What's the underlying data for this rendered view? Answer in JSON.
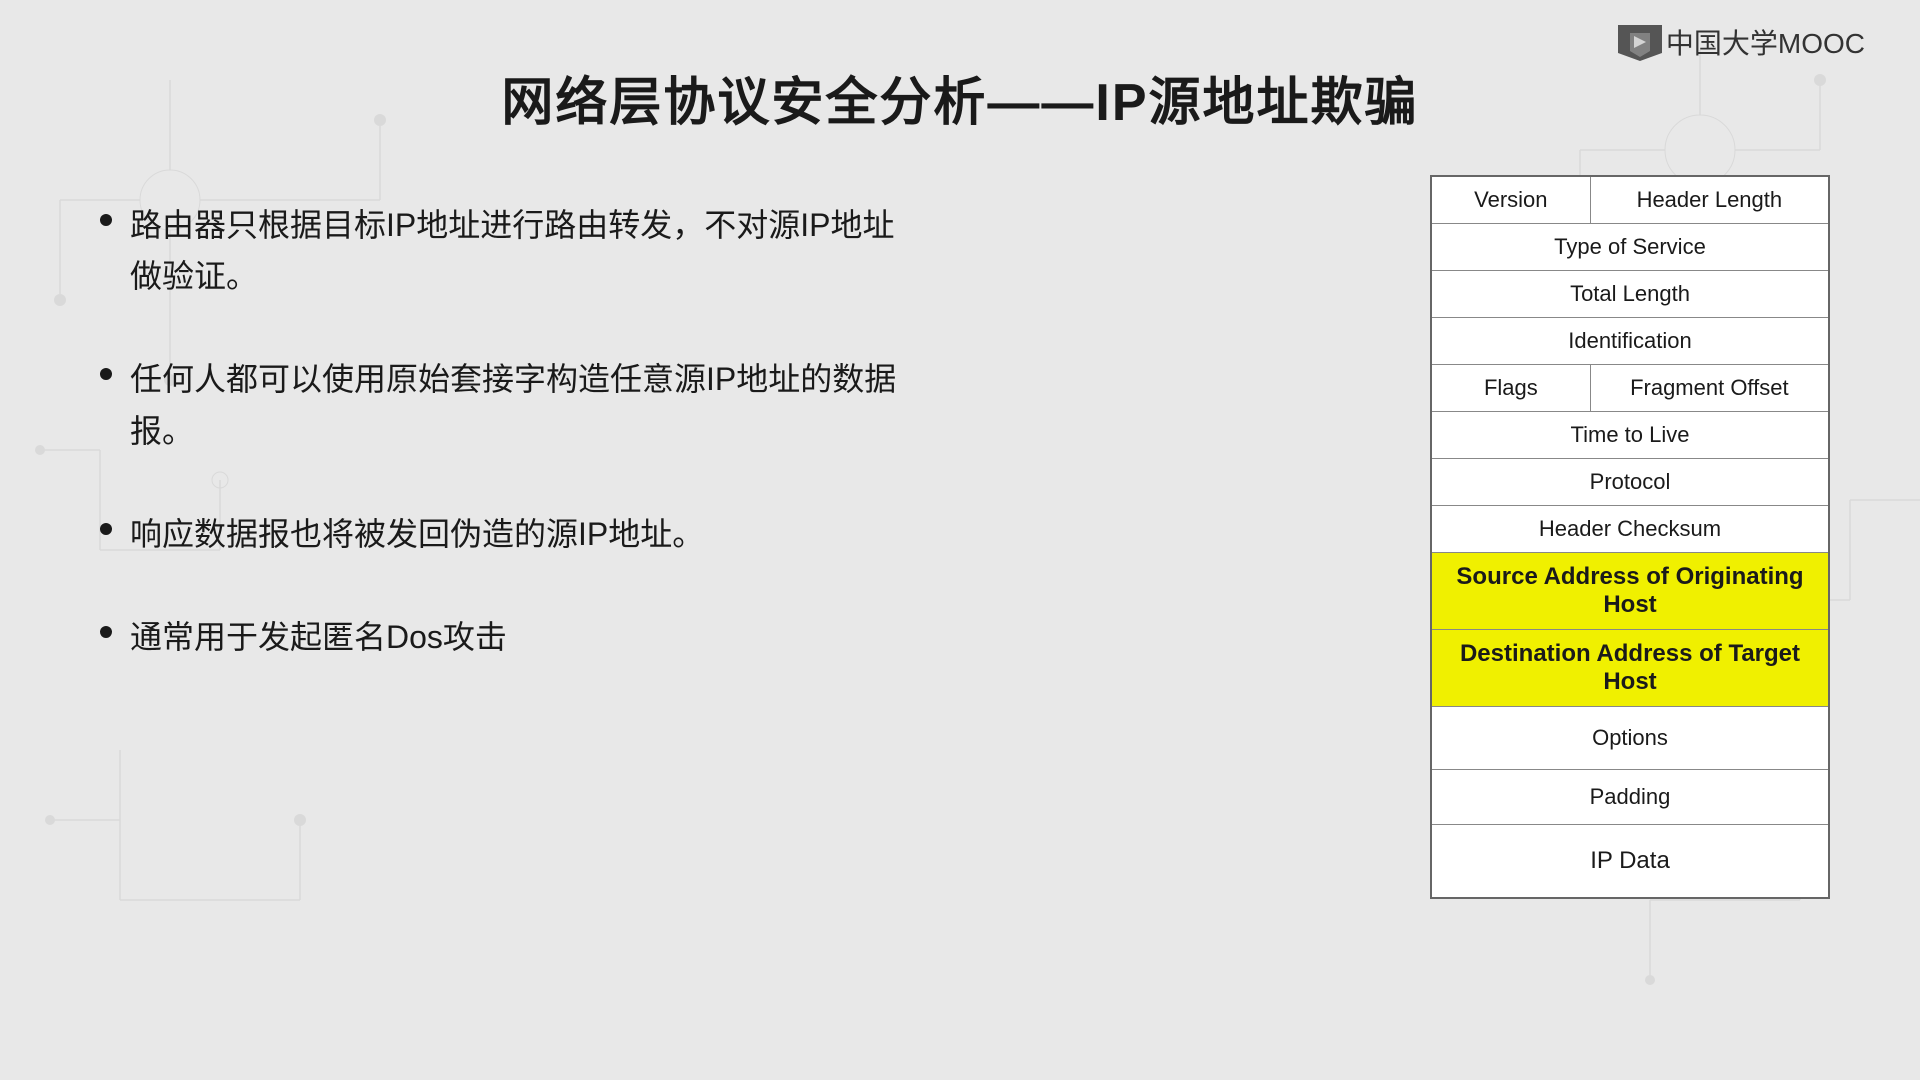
{
  "logo": {
    "text": "中国大学MOOC"
  },
  "title": "网络层协议安全分析——IP源地址欺骗",
  "bullets": [
    {
      "text": "路由器只根据目标IP地址进行路由转发，不对源IP地址做验证。"
    },
    {
      "text": "任何人都可以使用原始套接字构造任意源IP地址的数据报。"
    },
    {
      "text": "响应数据报也将被发回伪造的源IP地址。"
    },
    {
      "text": "通常用于发起匿名Dos攻击"
    }
  ],
  "ip_header": {
    "rows": [
      {
        "type": "two-col",
        "col1": "Version",
        "col2": "Header Length"
      },
      {
        "type": "single",
        "text": "Type of Service"
      },
      {
        "type": "single",
        "text": "Total Length"
      },
      {
        "type": "single",
        "text": "Identification"
      },
      {
        "type": "two-col",
        "col1": "Flags",
        "col2": "Fragment Offset"
      },
      {
        "type": "single",
        "text": "Time to Live"
      },
      {
        "type": "single",
        "text": "Protocol"
      },
      {
        "type": "single",
        "text": "Header Checksum"
      },
      {
        "type": "single",
        "text": "Source Address of Originating Host",
        "highlight": true
      },
      {
        "type": "single",
        "text": "Destination Address of Target Host",
        "highlight": true
      },
      {
        "type": "single",
        "text": "Options",
        "tall": true
      },
      {
        "type": "single",
        "text": "Padding"
      },
      {
        "type": "single",
        "text": "IP Data",
        "tall": true
      }
    ]
  }
}
